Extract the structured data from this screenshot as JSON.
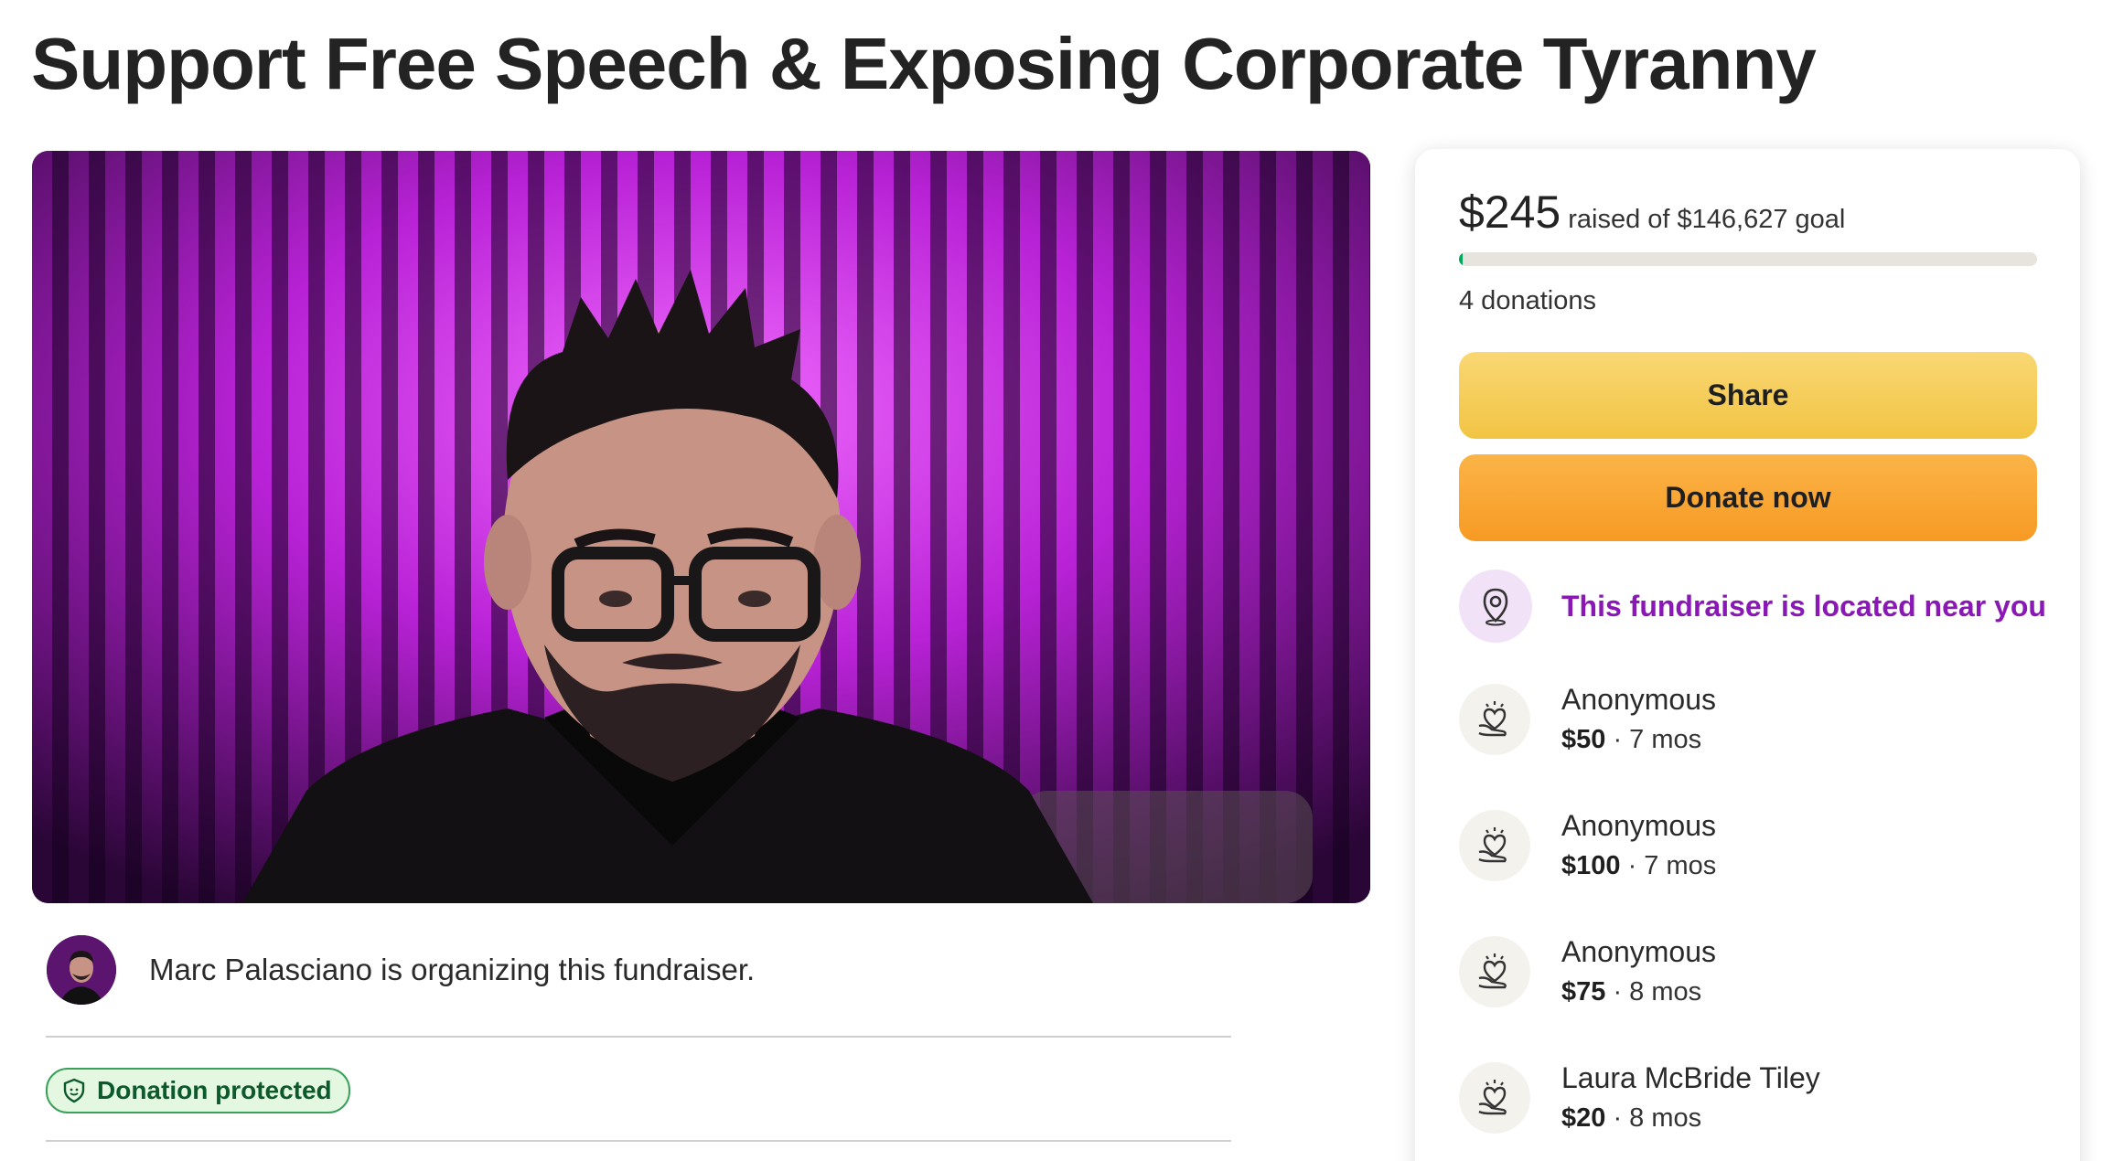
{
  "page": {
    "title": "Support Free Speech & Exposing Corporate Tyranny"
  },
  "hero": {
    "image": "portrait-photo"
  },
  "organizer": {
    "name": "Marc Palasciano",
    "text": "Marc Palasciano is organizing this fundraiser."
  },
  "badge": {
    "label": "Donation protected",
    "icon": "shield-icon"
  },
  "card": {
    "raised_amount": "$245",
    "raised_text": "raised of $146,627 goal",
    "progress_fraction": 0.0017,
    "donations_count": "4 donations",
    "share_label": "Share",
    "donate_label": "Donate now",
    "near_text": "This fundraiser is located near you",
    "near_icon": "location-pin-icon"
  },
  "donors": [
    {
      "name": "Anonymous",
      "amount": "$50",
      "time": " · 7 mos"
    },
    {
      "name": "Anonymous",
      "amount": "$100",
      "time": " · 7 mos"
    },
    {
      "name": "Anonymous",
      "amount": "$75",
      "time": " · 8 mos"
    },
    {
      "name": "Laura McBride Tiley",
      "amount": "$20",
      "time": " · 8 mos"
    }
  ],
  "colors": {
    "accent_green": "#02a95c",
    "share_yellow": "#f2c443",
    "donate_orange": "#f79a24",
    "near_purple": "#8a18b5"
  }
}
